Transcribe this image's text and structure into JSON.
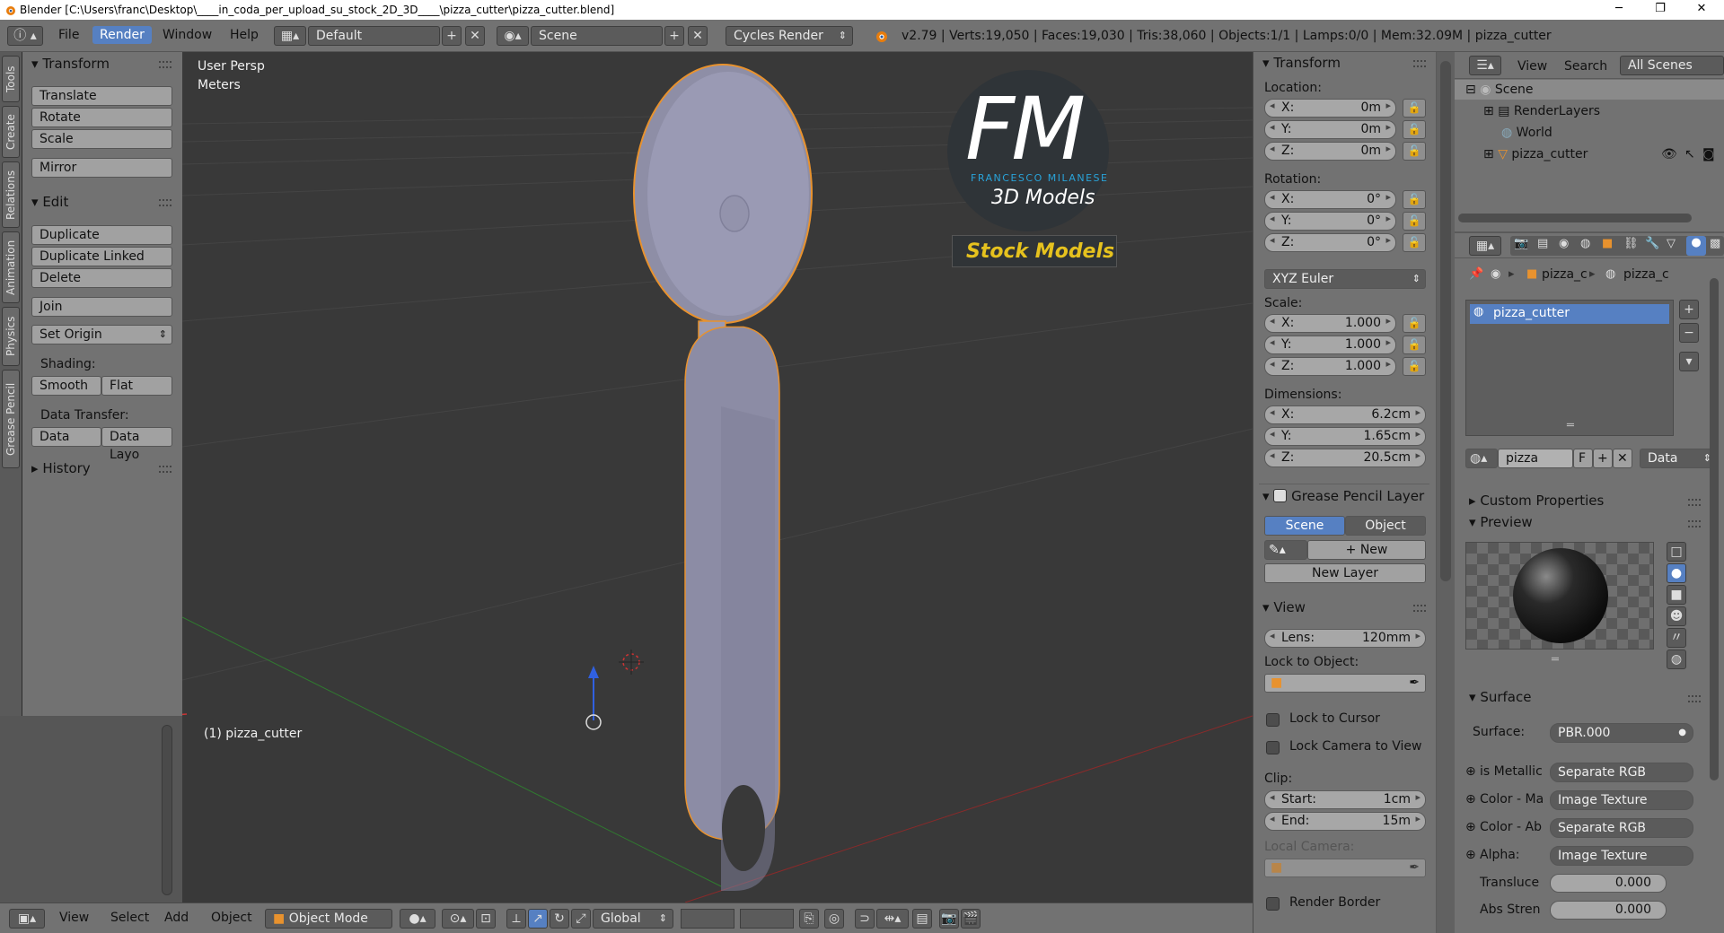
{
  "window": {
    "title": "Blender [C:\\Users\\franc\\Desktop\\____in_coda_per_upload_su_stock_2D_3D____\\pizza_cutter\\pizza_cutter.blend]",
    "min": "─",
    "max": "❐",
    "close": "✕"
  },
  "topbar": {
    "menus": [
      "File",
      "Render",
      "Window",
      "Help"
    ],
    "layout": "Default",
    "scene": "Scene",
    "engine": "Cycles Render",
    "status": "v2.79 | Verts:19,050 | Faces:19,030 | Tris:38,060 | Objects:1/1 | Lamps:0/0 | Mem:32.09M | pizza_cutter"
  },
  "left_tabs": [
    "Tools",
    "Create",
    "Relations",
    "Animation",
    "Physics",
    "Grease Pencil"
  ],
  "tool_shelf": {
    "transform_title": "Transform",
    "translate": "Translate",
    "rotate": "Rotate",
    "scale": "Scale",
    "mirror": "Mirror",
    "edit_title": "Edit",
    "duplicate": "Duplicate",
    "duplicate_linked": "Duplicate Linked",
    "delete": "Delete",
    "join": "Join",
    "set_origin": "Set Origin",
    "shading_label": "Shading:",
    "smooth": "Smooth",
    "flat": "Flat",
    "data_transfer_label": "Data Transfer:",
    "data": "Data",
    "data_layo": "Data Layo",
    "history": "History"
  },
  "viewport": {
    "view_name": "User Persp",
    "units": "Meters",
    "object_label": "(1) pizza_cutter",
    "logo_letters": "FM",
    "logo_name": "FRANCESCO MILANESE",
    "logo_sub": "3D Models",
    "logo_stock": "Stock Models"
  },
  "bottombar": {
    "view": "View",
    "select": "Select",
    "add": "Add",
    "object": "Object",
    "mode": "Object Mode",
    "orientation": "Global"
  },
  "npanel": {
    "transform_title": "Transform",
    "location_label": "Location:",
    "loc": [
      {
        "k": "X:",
        "v": "0m"
      },
      {
        "k": "Y:",
        "v": "0m"
      },
      {
        "k": "Z:",
        "v": "0m"
      }
    ],
    "rotation_label": "Rotation:",
    "rot": [
      {
        "k": "X:",
        "v": "0°"
      },
      {
        "k": "Y:",
        "v": "0°"
      },
      {
        "k": "Z:",
        "v": "0°"
      }
    ],
    "rot_mode": "XYZ Euler",
    "scale_label": "Scale:",
    "scl": [
      {
        "k": "X:",
        "v": "1.000"
      },
      {
        "k": "Y:",
        "v": "1.000"
      },
      {
        "k": "Z:",
        "v": "1.000"
      }
    ],
    "dimensions_label": "Dimensions:",
    "dim": [
      {
        "k": "X:",
        "v": "6.2cm"
      },
      {
        "k": "Y:",
        "v": "1.65cm"
      },
      {
        "k": "Z:",
        "v": "20.5cm"
      }
    ],
    "gp_title": "Grease Pencil Layer",
    "gp_scene": "Scene",
    "gp_object": "Object",
    "gp_new": "New",
    "gp_new_layer": "New Layer",
    "view_title": "View",
    "lens_k": "Lens:",
    "lens_v": "120mm",
    "lock_obj": "Lock to Object:",
    "lock_cursor": "Lock to Cursor",
    "lock_camera": "Lock Camera to View",
    "clip_label": "Clip:",
    "clip_start_k": "Start:",
    "clip_start_v": "1cm",
    "clip_end_k": "End:",
    "clip_end_v": "15m",
    "local_camera": "Local Camera:",
    "render_border": "Render Border"
  },
  "outliner": {
    "view": "View",
    "search": "Search",
    "filter": "All Scenes",
    "scene": "Scene",
    "renderlayers": "RenderLayers",
    "world": "World",
    "object": "pizza_cutter"
  },
  "properties": {
    "crumb1": "pizza_c",
    "crumb2": "pizza_c",
    "material_slot": "pizza_cutter",
    "mat_name": "pizza",
    "mat_f": "F",
    "mat_data": "Data",
    "custom_props": "Custom Properties",
    "preview": "Preview",
    "surface": "Surface",
    "surface_label": "Surface:",
    "surface_value": "PBR.000",
    "rows": [
      {
        "k": "is Metallic",
        "v": "Separate RGB"
      },
      {
        "k": "Color - Ma",
        "v": "Image Texture"
      },
      {
        "k": "Color - Ab",
        "v": "Separate RGB"
      },
      {
        "k": "Alpha:",
        "v": "Image Texture"
      }
    ],
    "translu_k": "Transluce",
    "translu_v": "0.000",
    "absstren_k": "Abs Stren",
    "absstren_v": "0.000"
  },
  "colors": {
    "accent": "#5680c2",
    "selection": "#f19a2e",
    "logo_blue": "#29a3d9",
    "logo_yellow": "#e6c21e"
  }
}
